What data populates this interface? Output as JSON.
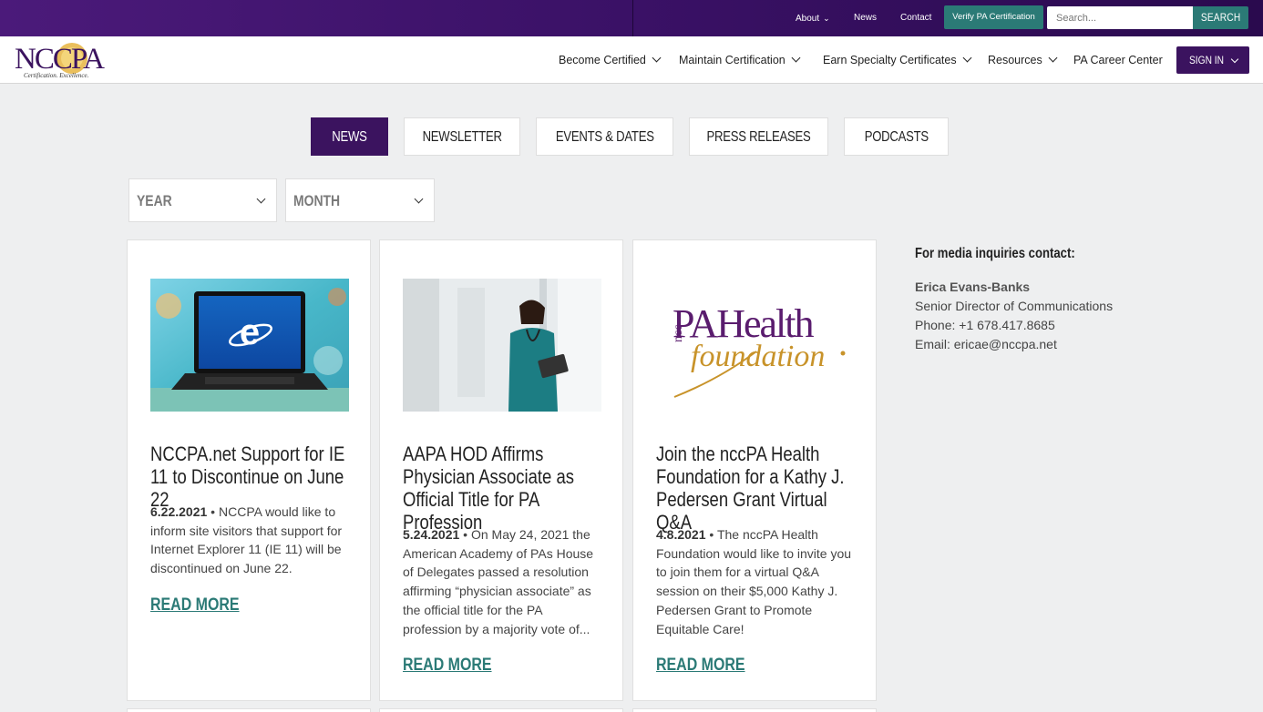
{
  "topbar": {
    "about": "About",
    "news": "News",
    "contact": "Contact",
    "verify": "Verify PA Certification",
    "search_placeholder": "Search...",
    "search_button": "SEARCH"
  },
  "logo": {
    "text": "NCCPA",
    "tagline": "Certification. Excellence."
  },
  "nav": {
    "items": [
      {
        "label": "Become Certified"
      },
      {
        "label": "Maintain Certification"
      },
      {
        "label": "Earn Specialty Certificates"
      },
      {
        "label": "Resources"
      },
      {
        "label": "PA Career Center"
      }
    ],
    "signin": "SIGN IN"
  },
  "tabs": [
    {
      "label": "NEWS",
      "active": true
    },
    {
      "label": "NEWSLETTER"
    },
    {
      "label": "EVENTS & DATES"
    },
    {
      "label": "PRESS RELEASES"
    },
    {
      "label": "PODCASTS"
    }
  ],
  "filters": {
    "year": "YEAR",
    "month": "MONTH"
  },
  "cards": [
    {
      "title": "NCCPA.net Support for IE 11 to Discontinue on June 22",
      "date": "6.22.2021",
      "text": "NCCPA would like to inform site visitors that support for Internet Explorer 11 (IE 11) will be discontinued on June 22.",
      "readmore": "READ MORE"
    },
    {
      "title": "AAPA HOD Affirms Physician Associate as Official Title for PA Profession",
      "date": "5.24.2021",
      "text": "On May 24, 2021 the American Academy of PAs House of Delegates passed a resolution affirming “physician associate” as the official title for the PA profession by a majority vote of...",
      "readmore": "READ MORE"
    },
    {
      "title": "Join the nccPA Health Foundation for a Kathy J. Pedersen Grant Virtual Q&A",
      "date": "4.8.2021",
      "text": "The nccPA Health Foundation would like to invite you to join them for a virtual Q&A session on their $5,000 Kathy J. Pedersen Grant to Promote Equitable Care!",
      "readmore": "READ MORE",
      "logo_main": "PAHealth",
      "logo_prefix": "ncc",
      "logo_sub": "foundation"
    }
  ],
  "media": {
    "heading": "For media inquiries contact:",
    "name": "Erica Evans-Banks",
    "role": "Senior Director of Communications",
    "phone": "Phone: +1 678.417.8685",
    "email": "Email: ericae@nccpa.net"
  },
  "colors": {
    "brand_purple": "#3b135f",
    "teal": "#2b7a76",
    "gold": "#c8932a"
  }
}
